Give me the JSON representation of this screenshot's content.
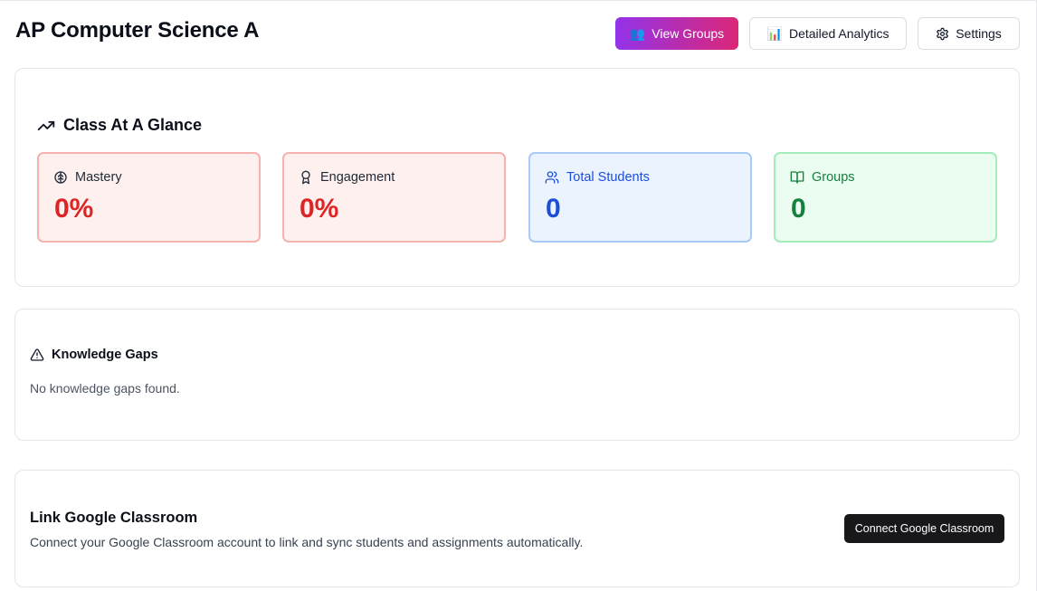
{
  "page": {
    "title": "AP Computer Science A"
  },
  "header": {
    "view_groups_label": "View Groups",
    "view_groups_emoji": "👥",
    "analytics_label": "Detailed Analytics",
    "analytics_emoji": "📊",
    "settings_label": "Settings"
  },
  "glance": {
    "title": "Class At A Glance",
    "stats": [
      {
        "label": "Mastery",
        "value": "0%",
        "icon": "brain-icon"
      },
      {
        "label": "Engagement",
        "value": "0%",
        "icon": "award-icon"
      },
      {
        "label": "Total Students",
        "value": "0",
        "icon": "users-icon"
      },
      {
        "label": "Groups",
        "value": "0",
        "icon": "book-open-icon"
      }
    ]
  },
  "gaps": {
    "title": "Knowledge Gaps",
    "empty_text": "No knowledge gaps found."
  },
  "link": {
    "title": "Link Google Classroom",
    "description": "Connect your Google Classroom account to link and sync students and assignments automatically.",
    "button_label": "Connect Google Classroom"
  },
  "colors": {
    "primary_gradient_start": "#9333ea",
    "primary_gradient_end": "#db2777",
    "red": "#dc2626",
    "blue": "#1d4ed8",
    "green": "#15803d",
    "dark_button": "#18181b"
  }
}
